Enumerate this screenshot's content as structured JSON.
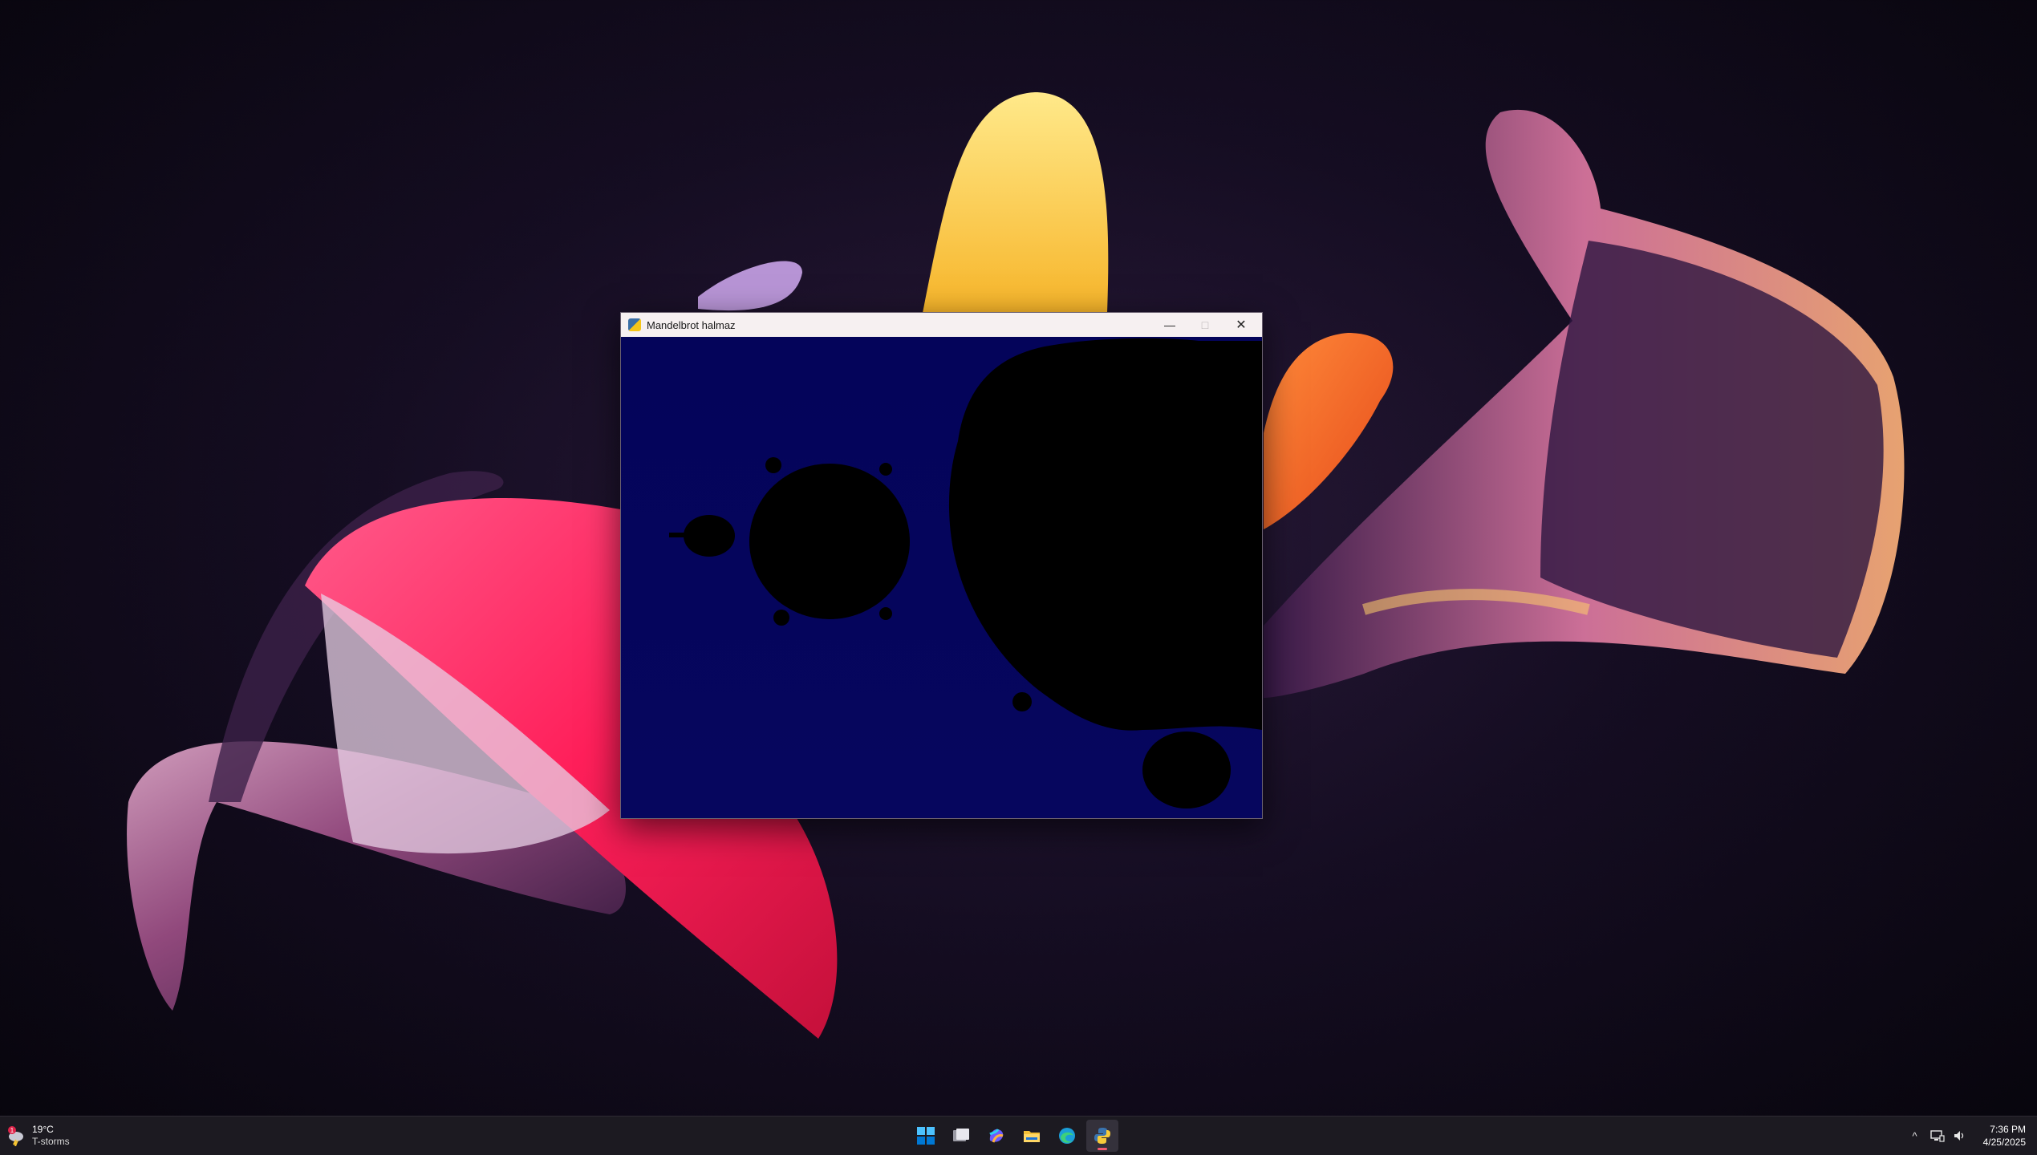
{
  "window": {
    "title": "Mandelbrot halmaz",
    "minimize_symbol": "—",
    "maximize_symbol": "□",
    "close_symbol": "✕",
    "background_color": "#05055c",
    "set_color": "#000000"
  },
  "taskbar": {
    "weather": {
      "temp": "19°C",
      "condition": "T-storms",
      "badge": "1",
      "icon": "thunderstorm-icon"
    },
    "apps": [
      {
        "name": "start",
        "icon": "windows-start-icon"
      },
      {
        "name": "task-view",
        "icon": "task-view-icon"
      },
      {
        "name": "copilot",
        "icon": "copilot-icon"
      },
      {
        "name": "file-explorer",
        "icon": "folder-icon"
      },
      {
        "name": "edge",
        "icon": "edge-browser-icon"
      },
      {
        "name": "python",
        "icon": "python-icon",
        "active": true
      }
    ],
    "tray": {
      "chevron": "^",
      "date": "4/25/2025",
      "time": "7:36 PM"
    }
  }
}
